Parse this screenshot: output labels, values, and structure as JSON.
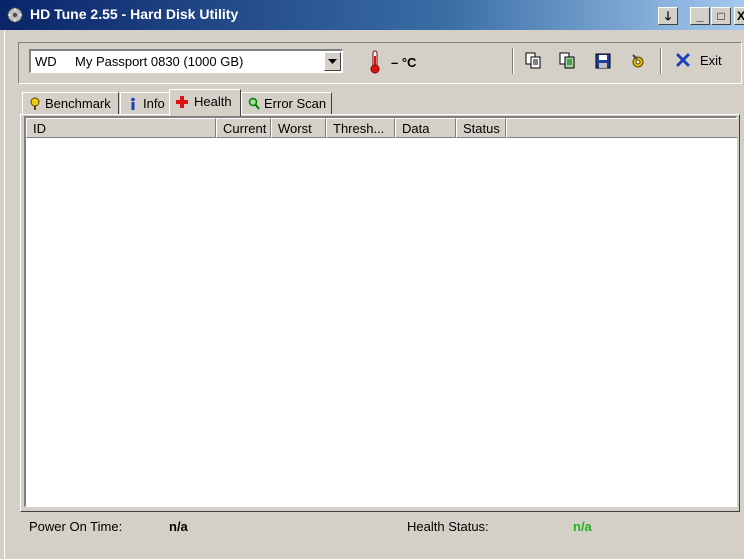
{
  "window": {
    "title": "HD Tune 2.55 - Hard Disk Utility",
    "buttons": {
      "extra": "🡓",
      "minimize": "_",
      "maximize": "□",
      "close": "X"
    }
  },
  "drive": {
    "vendor": "WD",
    "model": "My Passport 0830 (1000 GB)"
  },
  "temperature": {
    "value": "– °C"
  },
  "toolbar": {
    "exit_label": "Exit"
  },
  "tabs": [
    {
      "label": "Benchmark",
      "icon": "benchmark-icon"
    },
    {
      "label": "Info",
      "icon": "info-icon"
    },
    {
      "label": "Health",
      "icon": "health-cross-icon",
      "active": true
    },
    {
      "label": "Error Scan",
      "icon": "magnifier-icon"
    }
  ],
  "table": {
    "columns": [
      "ID",
      "Current",
      "Worst",
      "Thresh...",
      "Data",
      "Status"
    ],
    "rows": []
  },
  "status": {
    "power_on_label": "Power On Time:",
    "power_on_value": "n/a",
    "health_label": "Health Status:",
    "health_value": "n/a"
  },
  "colors": {
    "health_value": "#1fb31f",
    "titlebar_start": "#0a246a",
    "exit_x": "#1c3fbf"
  }
}
